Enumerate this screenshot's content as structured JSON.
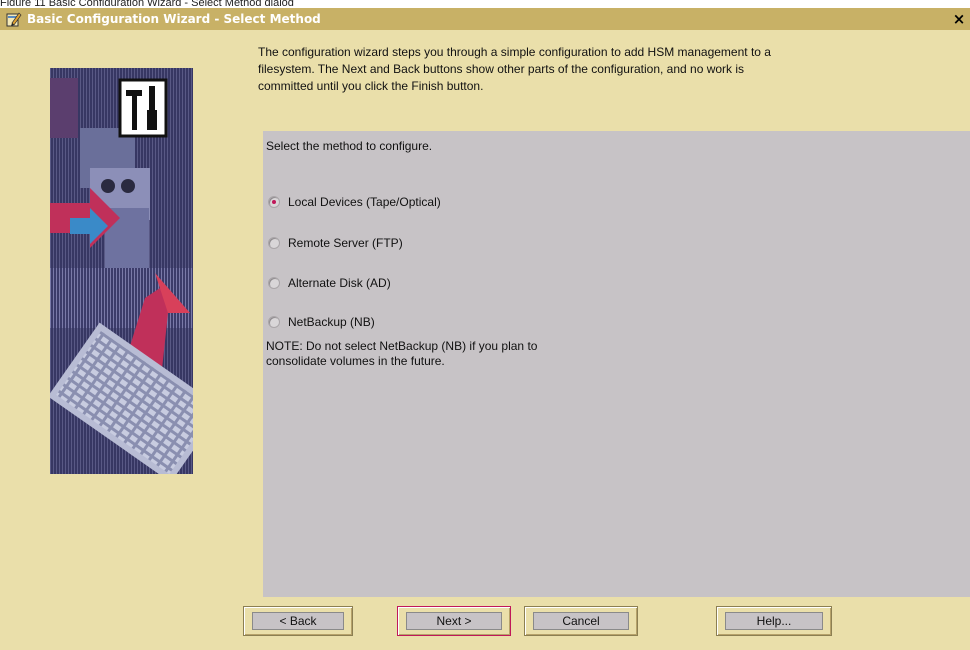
{
  "cropped_header": "Figure 11  Basic Configuration Wizard - Select Method dialog",
  "window": {
    "title": "Basic Configuration Wizard - Select Method",
    "icon": "wizard-pencil-icon",
    "close": "×"
  },
  "side_image": {
    "icon": "tools-hammer-screwdriver-icon"
  },
  "intro": {
    "line1": "The configuration wizard steps you through a simple configuration to add HSM management to a",
    "line2": "filesystem.  The Next and Back buttons show other parts of the configuration, and no work is",
    "line3": "committed until you click the Finish button."
  },
  "panel": {
    "prompt": "Select the method to configure.",
    "options": [
      {
        "label": "Local Devices (Tape/Optical)",
        "selected": true
      },
      {
        "label": "Remote Server (FTP)",
        "selected": false
      },
      {
        "label": "Alternate Disk (AD)",
        "selected": false
      },
      {
        "label": "NetBackup (NB)",
        "selected": false
      }
    ],
    "note_line1": "NOTE: Do not select NetBackup (NB) if you plan to",
    "note_line2": "consolidate volumes in the future."
  },
  "buttons": {
    "back": "< Back",
    "next": "Next >",
    "cancel": "Cancel",
    "help": "Help..."
  },
  "colors": {
    "window_bg": "#eadfaa",
    "titlebar": "#c8b166",
    "panel": "#c7c3c6",
    "radio_dot": "#c0185a"
  }
}
